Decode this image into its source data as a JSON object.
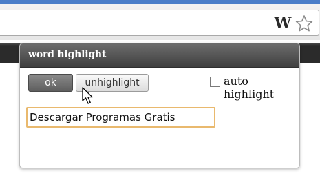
{
  "browser": {
    "extension_icon": "w-extension-icon",
    "extension_icon_text": "W",
    "bookmark_icon": "star-icon"
  },
  "popup": {
    "title": "word highlight",
    "ok_label": "ok",
    "unhighlight_label": "unhighlight",
    "auto_highlight_label": "auto highlight",
    "auto_highlight_checked": false,
    "search_value": "Descargar Programas Gratis",
    "cursor_icon": "mouse-pointer-icon"
  },
  "colors": {
    "header": "#4f4f4f",
    "ok_button": "#6e6e6e",
    "field_focus": "#e9b96e"
  }
}
